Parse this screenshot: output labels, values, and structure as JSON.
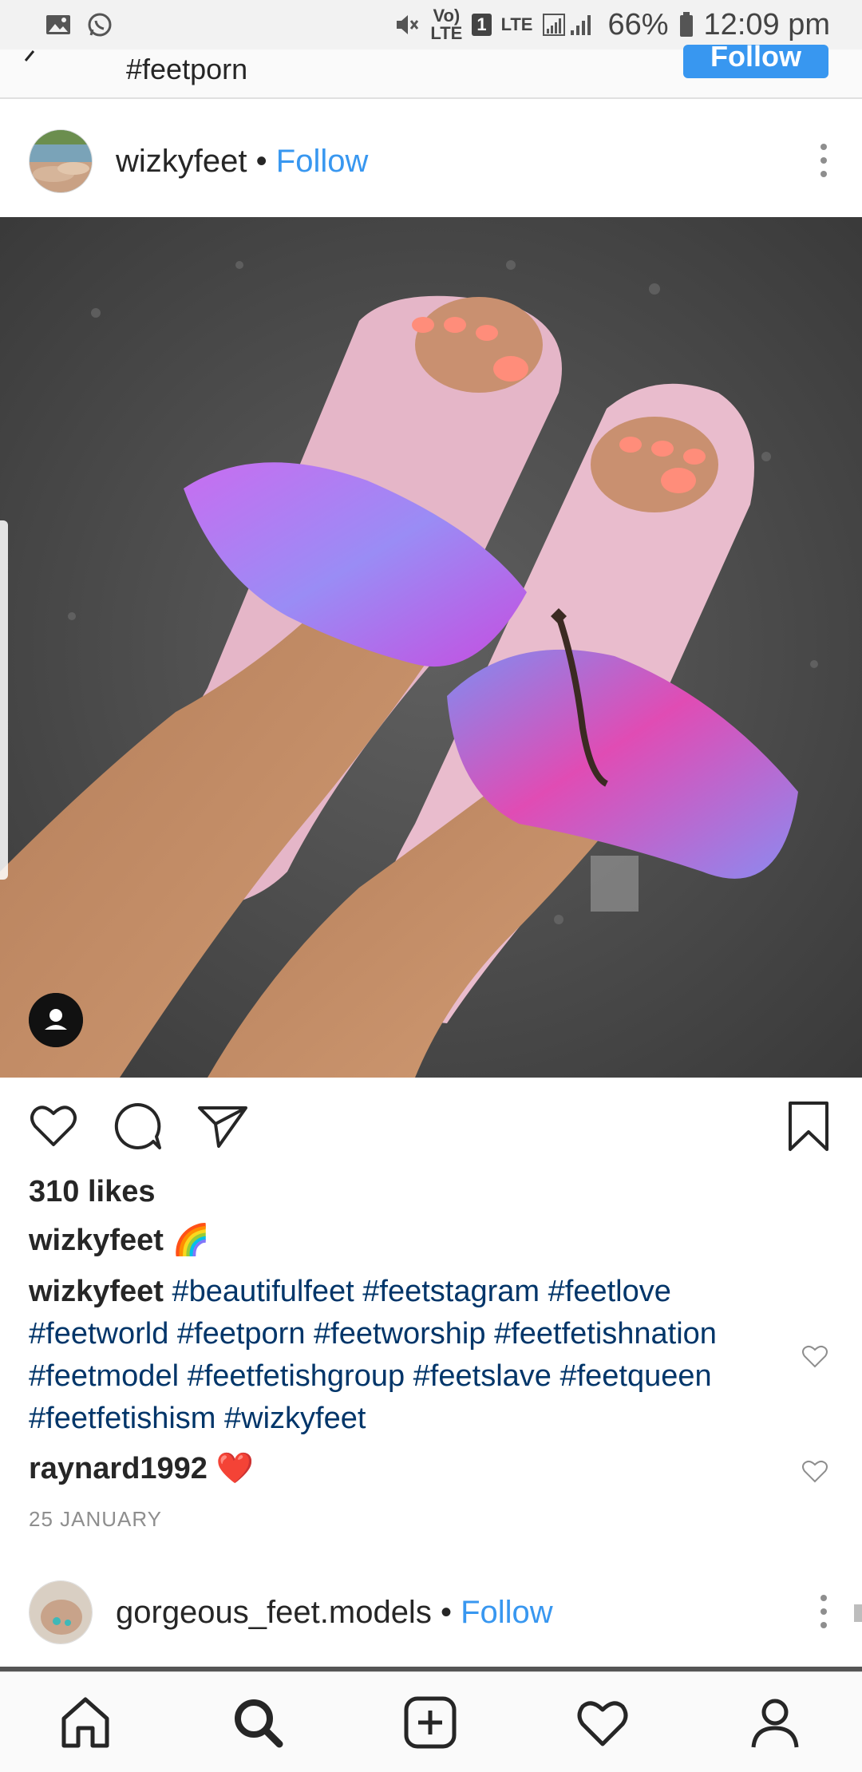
{
  "status_bar": {
    "volte_top": "Vo)",
    "volte_bottom": "LTE",
    "sim": "1",
    "lte": "LTE",
    "battery": "66%",
    "time": "12:09 pm"
  },
  "header": {
    "title": "#feetporn",
    "follow_label": "Follow"
  },
  "post": {
    "username": "wizkyfeet",
    "separator": "•",
    "follow_label": "Follow",
    "likes": "310 likes",
    "caption_user": "wizkyfeet",
    "caption_emoji": "🌈",
    "comment_user": "wizkyfeet",
    "hashtags": [
      "#beautifulfeet",
      "#feetstagram",
      "#feetlove",
      "#feetworld",
      "#feetporn",
      "#feetworship",
      "#feetfetishnation",
      "#feetmodel",
      "#feetfetishgroup",
      "#feetslave",
      "#feetqueen",
      "#feetfetishism",
      "#wizkyfeet"
    ],
    "reply_user": "raynard1992",
    "reply_emoji": "❤️",
    "date": "25 JANUARY"
  },
  "next_post": {
    "username": "gorgeous_feet.models",
    "separator": "•",
    "follow_label": "Follow"
  },
  "icons": {
    "nav": [
      "home-icon",
      "search-icon",
      "add-post-icon",
      "activity-heart-icon",
      "profile-icon"
    ],
    "actions": [
      "like-heart-icon",
      "comment-bubble-icon",
      "share-send-icon",
      "save-bookmark-icon"
    ]
  },
  "colors": {
    "accent": "#3897f0",
    "hashtag": "#003569",
    "text": "#262626",
    "muted": "#8e8e8e"
  }
}
